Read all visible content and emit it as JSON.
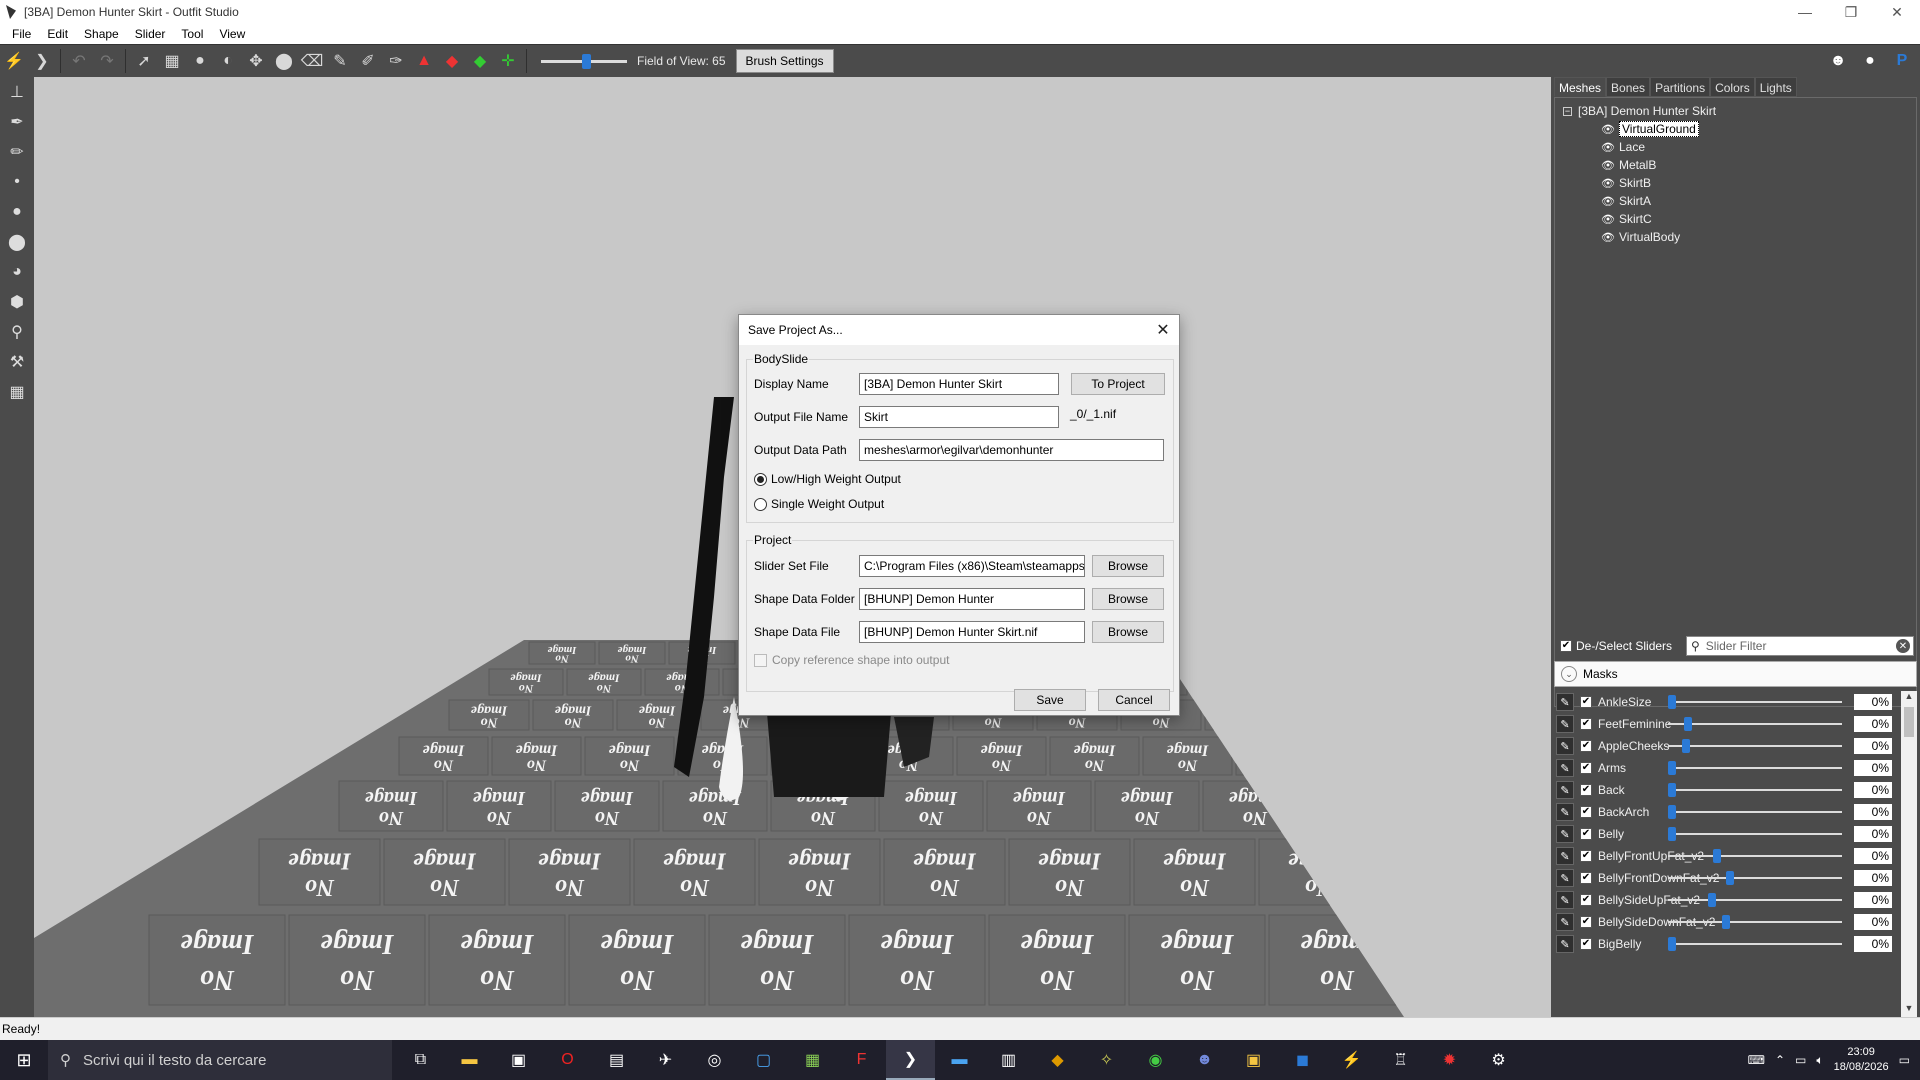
{
  "window": {
    "title": "[3BA] Demon Hunter Skirt - Outfit Studio",
    "controls": [
      "—",
      "❐",
      "✕"
    ]
  },
  "menu": [
    "File",
    "Edit",
    "Shape",
    "Slider",
    "Tool",
    "View"
  ],
  "toolbar": {
    "fov_label": "Field of View: 65",
    "fov_value": 65,
    "brush_settings": "Brush Settings",
    "right_icons": [
      "discord-icon",
      "github-icon",
      "paypal-icon"
    ]
  },
  "viewport": {
    "placeholder_word": "Image",
    "placeholder_word2": "No"
  },
  "right_panel": {
    "tabs": [
      "Meshes",
      "Bones",
      "Partitions",
      "Colors",
      "Lights"
    ],
    "active_tab": "Meshes",
    "tree_root": "[3BA] Demon Hunter Skirt",
    "meshes": [
      "VirtualGround",
      "Lace",
      "MetalB",
      "SkirtB",
      "SkirtA",
      "SkirtC",
      "VirtualBody"
    ],
    "selected_mesh": "VirtualGround",
    "deselect_label": "De-/Select Sliders",
    "filter_placeholder": "Slider Filter",
    "masks_label": "Masks",
    "sliders": [
      {
        "name": "AnkleSize",
        "value": "0%",
        "level": 0.0
      },
      {
        "name": "FeetFeminine",
        "value": "0%",
        "level": 0.1
      },
      {
        "name": "AppleCheeks",
        "value": "0%",
        "level": 0.09
      },
      {
        "name": "Arms",
        "value": "0%",
        "level": -0.08
      },
      {
        "name": "Back",
        "value": "0%",
        "level": -0.1
      },
      {
        "name": "BackArch",
        "value": "0%",
        "level": 0.0
      },
      {
        "name": "Belly",
        "value": "0%",
        "level": -0.1
      },
      {
        "name": "BellyFrontUpFat_v2",
        "value": "0%",
        "level": 0.28
      },
      {
        "name": "BellyFrontDownFat_v2",
        "value": "0%",
        "level": 0.36
      },
      {
        "name": "BellySideUpFat_v2",
        "value": "0%",
        "level": 0.25
      },
      {
        "name": "BellySideDownFat_v2",
        "value": "0%",
        "level": 0.34
      },
      {
        "name": "BigBelly",
        "value": "0%",
        "level": -0.03
      }
    ]
  },
  "status": "Ready!",
  "taskbar": {
    "search_placeholder": "Scrivi qui il testo da cercare",
    "time": "23:09",
    "date": "18/08/2026"
  },
  "dialog": {
    "title": "Save Project As...",
    "bodyslide_group": "BodySlide",
    "display_name_label": "Display Name",
    "display_name_value": "[3BA] Demon Hunter Skirt",
    "to_project": "To Project",
    "output_file_label": "Output File Name",
    "output_file_value": "Skirt",
    "output_suffix": "_0/_1.nif",
    "output_path_label": "Output Data Path",
    "output_path_value": "meshes\\armor\\egilvar\\demonhunter",
    "radio_low_high": "Low/High Weight Output",
    "radio_single": "Single Weight Output",
    "project_group": "Project",
    "slider_set_label": "Slider Set File",
    "slider_set_value": "C:\\Program Files (x86)\\Steam\\steamapps",
    "shape_folder_label": "Shape Data Folder",
    "shape_folder_value": "[BHUNP] Demon Hunter",
    "shape_file_label": "Shape Data File",
    "shape_file_value": "[BHUNP] Demon Hunter Skirt.nif",
    "browse": "Browse",
    "copy_ref": "Copy reference shape into output",
    "save": "Save",
    "cancel": "Cancel"
  }
}
